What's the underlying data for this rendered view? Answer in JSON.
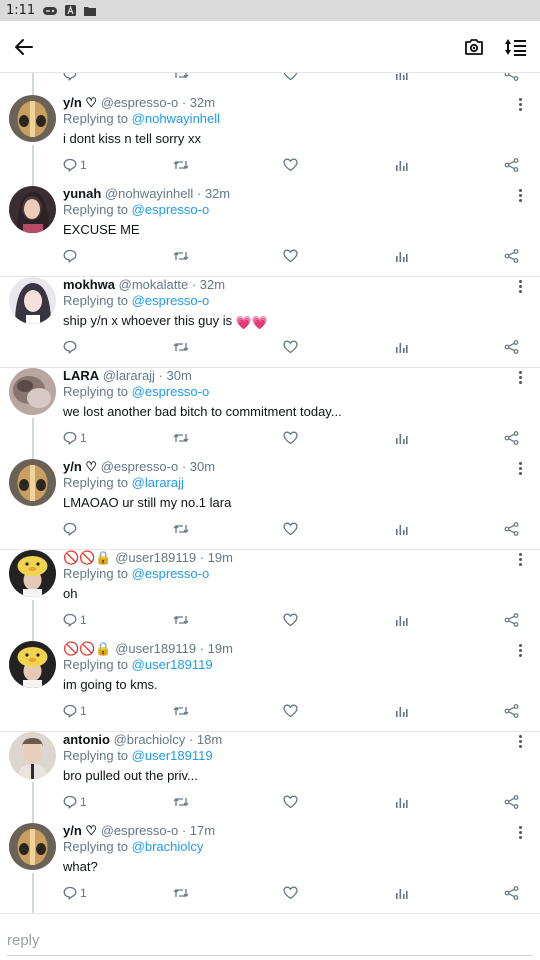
{
  "status_bar": {
    "time": "1:11"
  },
  "header": {
    "back_icon": "arrow-left-icon",
    "camera_icon": "camera-icon",
    "sort_icon": "sort-lines-icon"
  },
  "colors": {
    "link": "#1d9bf0",
    "muted": "#657786",
    "thread_line": "#cfd9de"
  },
  "tweets": [
    {
      "name": "y/n ♡",
      "handle": "@espresso-o",
      "time": "32m",
      "replying_prefix": "Replying to",
      "replying_to": "@nohwayinhell",
      "text": "i dont kiss n tell sorry xx",
      "reply_count": "1",
      "avatar": "helmet-avatar"
    },
    {
      "name": "yunah",
      "handle": "@nohwayinhell",
      "time": "32m",
      "replying_prefix": "Replying to",
      "replying_to": "@espresso-o",
      "text": "EXCUSE ME",
      "reply_count": "",
      "avatar": "girl-avatar"
    },
    {
      "name": "mokhwa",
      "handle": "@mokalatte",
      "time": "32m",
      "replying_prefix": "Replying to",
      "replying_to": "@espresso-o",
      "text": "ship y/n x whoever this guy is ",
      "text_emoji": "💗💗",
      "reply_count": "",
      "avatar": "girl-light-avatar"
    },
    {
      "name": "LARA",
      "handle": "@lararajj",
      "time": "30m",
      "replying_prefix": "Replying to",
      "replying_to": "@espresso-o",
      "text": "we lost another bad bitch to commitment today...",
      "reply_count": "1",
      "avatar": "blurred-avatar"
    },
    {
      "name": "y/n ♡",
      "handle": "@espresso-o",
      "time": "30m",
      "replying_prefix": "Replying to",
      "replying_to": "@lararajj",
      "text": "LMAOAO ur still my no.1 lara",
      "reply_count": "",
      "avatar": "helmet-avatar"
    },
    {
      "name": "🚫🚫🔒",
      "handle": "@user189119",
      "time": "19m",
      "replying_prefix": "Replying to",
      "replying_to": "@espresso-o",
      "text": "oh",
      "reply_count": "1",
      "avatar": "duck-hat-avatar"
    },
    {
      "name": "🚫🚫🔒",
      "handle": "@user189119",
      "time": "19m",
      "replying_prefix": "Replying to",
      "replying_to": "@user189119",
      "text": "im going to kms.",
      "reply_count": "1",
      "avatar": "duck-hat-avatar"
    },
    {
      "name": "antonio",
      "handle": "@brachiolcy",
      "time": "18m",
      "replying_prefix": "Replying to",
      "replying_to": "@user189119",
      "text": "bro pulled out the priv...",
      "reply_count": "1",
      "avatar": "boy-avatar"
    },
    {
      "name": "y/n ♡",
      "handle": "@espresso-o",
      "time": "17m",
      "replying_prefix": "Replying to",
      "replying_to": "@brachiolcy",
      "text": "what?",
      "reply_count": "1",
      "avatar": "helmet-avatar"
    }
  ],
  "reply_input": {
    "placeholder": "reply"
  }
}
